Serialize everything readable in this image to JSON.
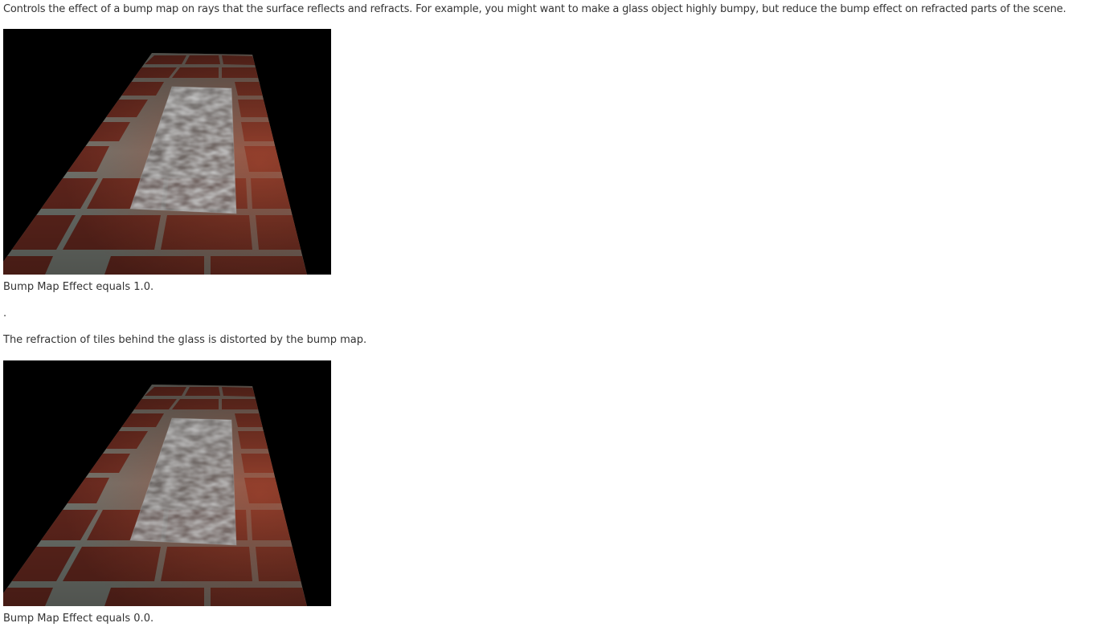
{
  "intro": "Controls the effect of a bump map on rays that the surface reflects and refracts. For example, you might want to make a glass object highly bumpy, but reduce the bump effect on refracted parts of the scene.",
  "figures": [
    {
      "caption": "Bump Map Effect equals 1.0."
    },
    {
      "caption": "Bump Map Effect equals 0.0."
    }
  ],
  "separator": ".",
  "description": "The refraction of tiles behind the glass is distorted by the bump map."
}
